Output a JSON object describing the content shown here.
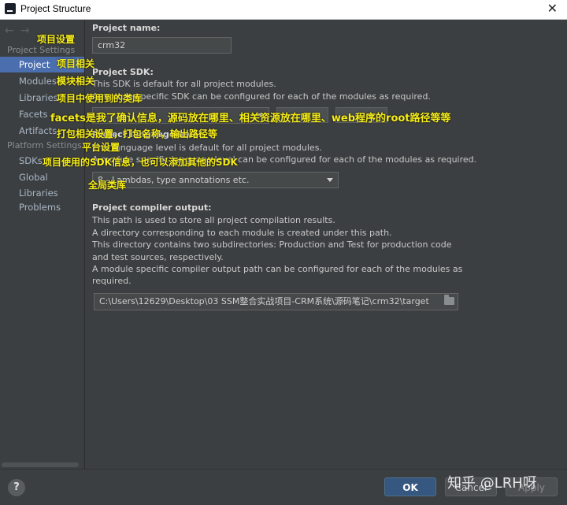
{
  "window": {
    "title": "Project Structure",
    "close_glyph": "✕"
  },
  "nav": {
    "back_glyph": "←",
    "forward_glyph": "→"
  },
  "sidebar": {
    "project_settings_header": "Project Settings",
    "project_items": [
      {
        "label": "Project",
        "selected": true
      },
      {
        "label": "Modules"
      },
      {
        "label": "Libraries"
      },
      {
        "label": "Facets"
      },
      {
        "label": "Artifacts"
      }
    ],
    "platform_settings_header": "Platform Settings",
    "platform_items": [
      {
        "label": "SDKs"
      },
      {
        "label": "Global Libraries"
      }
    ],
    "problems_label": "Problems"
  },
  "content": {
    "project_name_label": "Project name:",
    "project_name_value": "crm32",
    "sdk_label": "Project SDK:",
    "sdk_desc_1": "This SDK is default for all project modules.",
    "sdk_desc_2": "A module specific SDK can be configured for each of the modules as required.",
    "lang_label": "Project language level:",
    "lang_desc_1": "This language level is default for all project modules.",
    "lang_desc_2": "A module specific language level can be configured for each of the modules as required.",
    "lang_value": "8 - Lambdas, type annotations etc.",
    "compiler_label": "Project compiler output:",
    "compiler_desc": [
      "This path is used to store all project compilation results.",
      "A directory corresponding to each module is created under this path.",
      "This directory contains two subdirectories: Production and Test for production code",
      "and test sources, respectively.",
      "A module specific compiler output path can be configured for each of the modules as",
      "required."
    ],
    "compiler_path": "C:\\Users\\12629\\Desktop\\03 SSM整合实战项目-CRM系统\\源码笔记\\crm32\\target"
  },
  "footer": {
    "help_label": "?",
    "ok_label": "OK",
    "cancel_label": "Cancel",
    "apply_label": "Apply"
  },
  "watermark": "知乎 @LRH呀",
  "annotations": {
    "project_settings": "项目设置",
    "project": "项目相关",
    "modules": "模块相关",
    "libraries": "项目中使用到的类库",
    "facets": "facets是我了确认信息，源码放在哪里、相关资源放在哪里、web程序的root路径等等",
    "artifacts": "打包相关设置，打包名称，输出路径等",
    "platform": "平台设置",
    "sdks": "项目使用的SDK信息，也可以添加其他的SDK",
    "global_libraries": "全局类库"
  },
  "colors": {
    "background": "#3c3f41",
    "selection": "#4b6eaf",
    "annotation": "#f6ed18",
    "ok_button": "#365880"
  }
}
